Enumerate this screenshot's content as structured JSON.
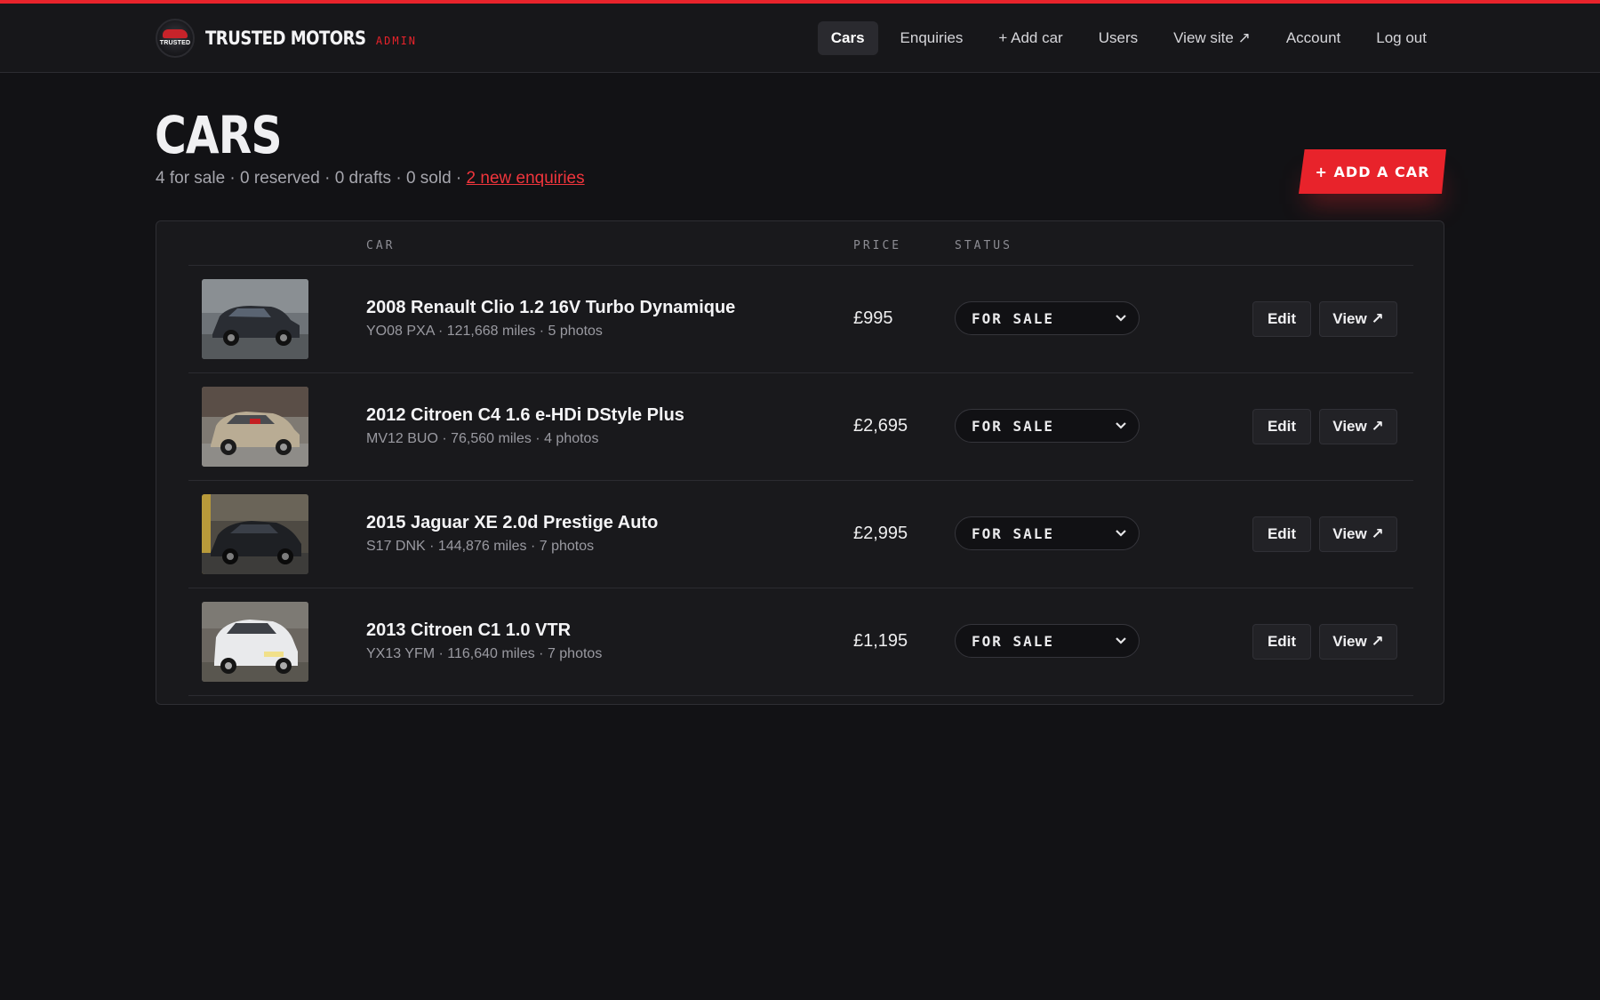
{
  "brand": {
    "logo_text": "TRUSTED",
    "name": "TRUSTED MOTORS",
    "sub": "ADMIN"
  },
  "nav": {
    "items": [
      {
        "label": "Cars",
        "active": true
      },
      {
        "label": "Enquiries"
      },
      {
        "label": "+ Add car"
      },
      {
        "label": "Users"
      },
      {
        "label": "View site ↗"
      },
      {
        "label": "Account"
      },
      {
        "label": "Log out"
      }
    ]
  },
  "page": {
    "title": "CARS",
    "summary": "4 for sale · 0 reserved · 0 drafts · 0 sold · ",
    "enquiries_link": "2 new enquiries",
    "add_button": "+ ADD A CAR"
  },
  "table": {
    "headers": {
      "car": "CAR",
      "price": "PRICE",
      "status": "STATUS"
    },
    "rows": [
      {
        "title": "2008 Renault Clio 1.2 16V Turbo Dynamique",
        "meta": "YO08 PXA · 121,668 miles · 5 photos",
        "price": "£995",
        "status": "FOR SALE",
        "edit": "Edit",
        "view": "View ↗",
        "car_color": "#2a2d33"
      },
      {
        "title": "2012 Citroen C4 1.6 e-HDi DStyle Plus",
        "meta": "MV12 BUO · 76,560 miles · 4 photos",
        "price": "£2,695",
        "status": "FOR SALE",
        "edit": "Edit",
        "view": "View ↗",
        "car_color": "#b9ac94"
      },
      {
        "title": "2015 Jaguar XE 2.0d Prestige Auto",
        "meta": "S17 DNK · 144,876 miles · 7 photos",
        "price": "£2,995",
        "status": "FOR SALE",
        "edit": "Edit",
        "view": "View ↗",
        "car_color": "#1e2024"
      },
      {
        "title": "2013 Citroen C1 1.0 VTR",
        "meta": "YX13 YFM · 116,640 miles · 7 photos",
        "price": "£1,195",
        "status": "FOR SALE",
        "edit": "Edit",
        "view": "View ↗",
        "car_color": "#e9eaec"
      }
    ]
  },
  "colors": {
    "accent": "#e8232b",
    "background": "#121215",
    "panel": "#19191c"
  }
}
